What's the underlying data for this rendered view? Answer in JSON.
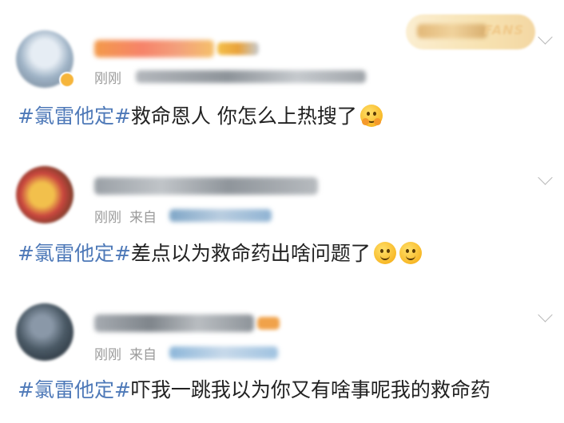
{
  "header_badge": {
    "text": "FANS"
  },
  "posts": [
    {
      "time": "刚刚",
      "source_prefix": "",
      "hashtag": "#氯雷他定#",
      "text": "救命恩人 你怎么上热搜了",
      "emojis": [
        "hug-emoji"
      ]
    },
    {
      "time": "刚刚",
      "source_prefix": "来自",
      "hashtag": "#氯雷他定#",
      "text": "差点以为救命药出啥问题了",
      "emojis": [
        "smile-emoji",
        "smile-emoji"
      ]
    },
    {
      "time": "刚刚",
      "source_prefix": "来自",
      "hashtag": "#氯雷他定#",
      "text": "吓我一跳我以为你又有啥事呢我的救命药",
      "emojis": []
    }
  ],
  "colors": {
    "hashtag": "#4e79b8",
    "meta": "#9b9b9b",
    "text": "#222222"
  },
  "icons": [
    "chevron-down-icon",
    "verified-badge-icon"
  ]
}
